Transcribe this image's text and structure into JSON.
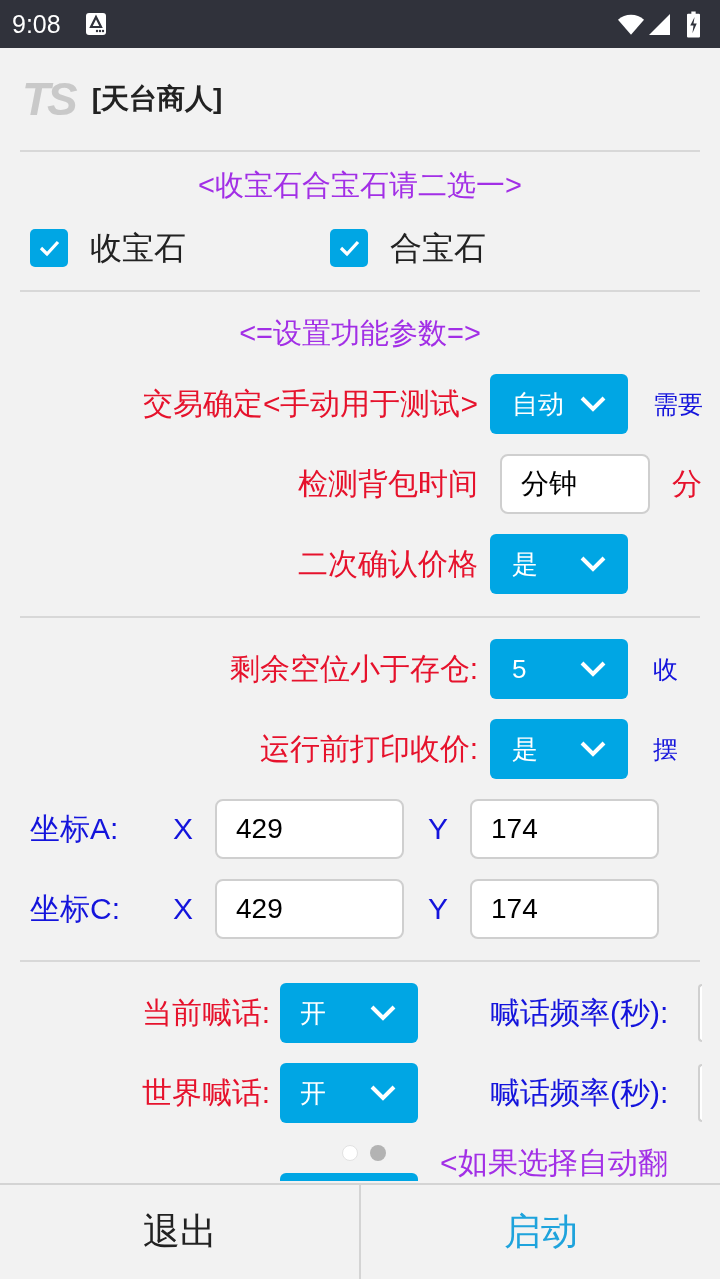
{
  "status_bar": {
    "time": "9:08"
  },
  "header": {
    "logo": "TS",
    "title": "[天台商人]"
  },
  "sections": [
    {
      "heading": "<收宝石合宝石请二选一>",
      "rows": [
        {
          "kind": "checks",
          "options": [
            {
              "label": "收宝石",
              "checked": true
            },
            {
              "label": "合宝石",
              "checked": true
            }
          ]
        }
      ]
    },
    {
      "heading": "<=设置功能参数=>",
      "rows": [
        {
          "kind": "select",
          "label": "交易确定<手动用于测试>",
          "value": "自动",
          "note": "需要"
        },
        {
          "kind": "field",
          "label": "检测背包时间",
          "value": "分钟",
          "suffix": "分"
        },
        {
          "kind": "select",
          "label": "二次确认价格",
          "value": "是"
        }
      ]
    },
    {
      "rows": [
        {
          "kind": "select",
          "label": "剩余空位小于存仓:",
          "value": "5",
          "note": "收"
        },
        {
          "kind": "select",
          "label": "运行前打印收价:",
          "value": "是",
          "note": "摆"
        },
        {
          "kind": "coord",
          "label": "坐标A:",
          "x_label": "X",
          "x_value": "429",
          "y_label": "Y",
          "y_value": "174"
        },
        {
          "kind": "coord",
          "label": "坐标C:",
          "x_label": "X",
          "x_value": "429",
          "y_label": "Y",
          "y_value": "174"
        }
      ]
    },
    {
      "rows": [
        {
          "kind": "shout",
          "label": "当前喊话:",
          "value": "开",
          "freq_label": "喊话频率(秒):"
        },
        {
          "kind": "shout",
          "label": "世界喊话:",
          "value": "开",
          "freq_label": "喊话频率(秒):"
        },
        {
          "kind": "partial",
          "note": "<如果选择自动翻"
        }
      ]
    }
  ],
  "page_indicator": [
    {
      "selected": false
    },
    {
      "selected": true
    }
  ],
  "bottom_bar": {
    "buttons": [
      {
        "label": "退出",
        "kind": "secondary"
      },
      {
        "label": "启动",
        "kind": "primary"
      }
    ]
  }
}
